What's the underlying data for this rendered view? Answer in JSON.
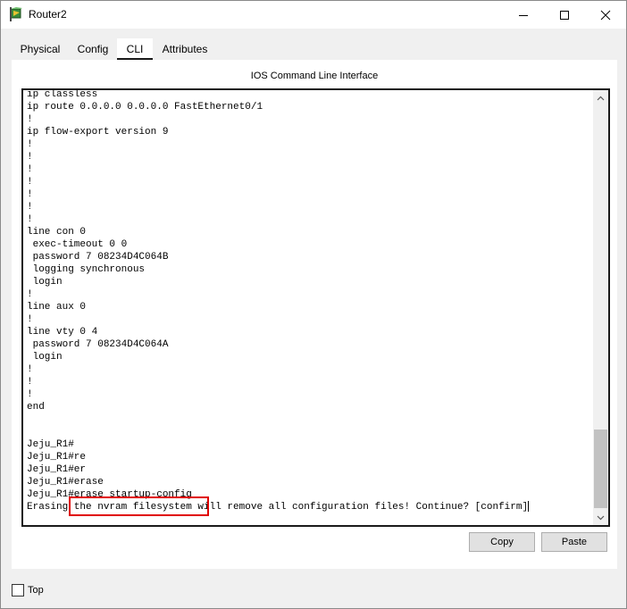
{
  "window": {
    "title": "Router2",
    "minimize_icon": "minimize-icon",
    "maximize_icon": "maximize-icon",
    "close_icon": "close-icon"
  },
  "tabs": [
    {
      "label": "Physical"
    },
    {
      "label": "Config"
    },
    {
      "label": "CLI",
      "active": true
    },
    {
      "label": "Attributes"
    }
  ],
  "cli": {
    "header": "IOS Command Line Interface",
    "lines": [
      "ip classless",
      "ip route 0.0.0.0 0.0.0.0 FastEthernet0/1",
      "!",
      "ip flow-export version 9",
      "!",
      "!",
      "!",
      "!",
      "!",
      "!",
      "!",
      "line con 0",
      " exec-timeout 0 0",
      " password 7 08234D4C064B",
      " logging synchronous",
      " login",
      "!",
      "line aux 0",
      "!",
      "line vty 0 4",
      " password 7 08234D4C064A",
      " login",
      "!",
      "!",
      "!",
      "end",
      "",
      "",
      "Jeju_R1#",
      "Jeju_R1#re",
      "Jeju_R1#er",
      "Jeju_R1#erase",
      "Jeju_R1#erase startup-config",
      "Erasing the nvram filesystem will remove all configuration files! Continue? [confirm]"
    ]
  },
  "buttons": {
    "copy": "Copy",
    "paste": "Paste"
  },
  "top_checkbox": {
    "label": "Top",
    "checked": false
  },
  "colors": {
    "highlight": "#e00000"
  }
}
